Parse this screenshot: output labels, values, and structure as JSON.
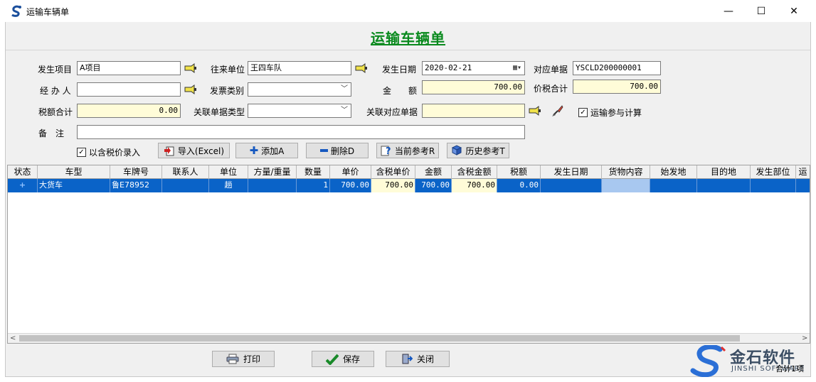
{
  "window": {
    "title": "运输车辆单",
    "min_glyph": "—",
    "max_glyph": "☐",
    "close_glyph": "✕"
  },
  "form": {
    "heading": "运输车辆单",
    "project_label": "发生项目",
    "project_value": "A项目",
    "partner_label": "往来单位",
    "partner_value": "王四车队",
    "date_label": "发生日期",
    "date_value": "2020-02-21",
    "ref_doc_label": "对应单据",
    "ref_doc_value": "YSCLD200000001",
    "handler_label": "经 办 人",
    "handler_value": "",
    "invoice_type_label": "发票类别",
    "invoice_type_value": "",
    "amount_label": "金　　额",
    "amount_value": "700.00",
    "price_tax_total_label": "价税合计",
    "price_tax_total_value": "700.00",
    "tax_total_label": "税额合计",
    "tax_total_value": "0.00",
    "linked_doc_type_label": "关联单据类型",
    "linked_doc_type_value": "",
    "linked_doc_label": "关联对应单据",
    "linked_doc_value": "",
    "transport_calc_label": "运输参与计算",
    "transport_calc_checked": true,
    "remark_label": "备　注",
    "remark_value": "",
    "tax_price_entry_label": "以含税价录入",
    "tax_price_entry_checked": true
  },
  "toolbar": {
    "import_label": "导入(Excel)",
    "add_label": "添加A",
    "delete_label": "删除D",
    "current_ref_label": "当前参考R",
    "history_ref_label": "历史参考T"
  },
  "grid": {
    "columns": [
      "状态",
      "车型",
      "车牌号",
      "联系人",
      "单位",
      "方量/重量",
      "数量",
      "单价",
      "含税单价",
      "金额",
      "含税金额",
      "税额",
      "发生日期",
      "货物内容",
      "始发地",
      "目的地",
      "发生部位",
      "运"
    ],
    "rows": [
      {
        "status": "+",
        "vehicle_type": "大货车",
        "plate": "鲁E78952",
        "contact": "",
        "unit": "趟",
        "volume_weight": "",
        "quantity": "1",
        "unit_price": "700.00",
        "tax_unit_price": "700.00",
        "amount": "700.00",
        "tax_amount": "700.00",
        "tax": "0.00",
        "date": "",
        "cargo": "",
        "origin": "",
        "destination": "",
        "department": ""
      }
    ]
  },
  "footer": {
    "print_label": "打印",
    "save_label": "保存",
    "close_label": "关闭",
    "total_label": "合计1项"
  },
  "brand": {
    "name_cn": "金石软件",
    "name_en": "JINSHI SOFTWARE"
  },
  "colors": {
    "heading_green": "#0a8a1e",
    "selection_blue": "#0a63c8",
    "readonly_yellow": "#fffcd8"
  }
}
